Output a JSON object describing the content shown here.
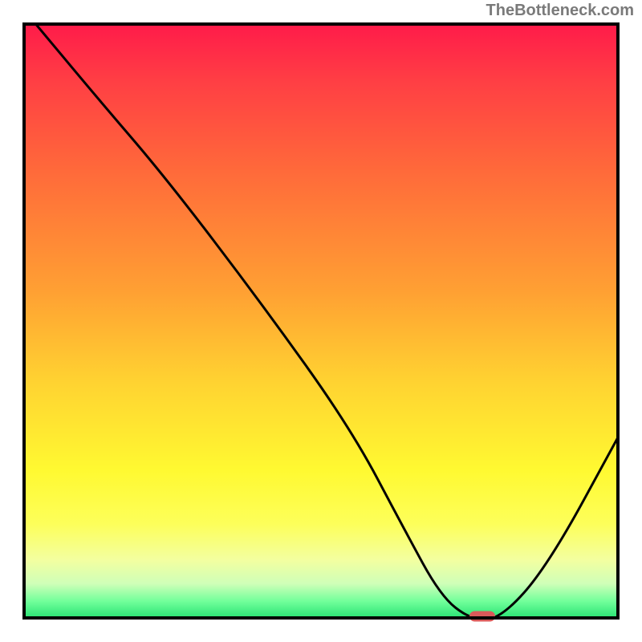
{
  "watermark": "TheBottleneck.com",
  "chart_data": {
    "type": "line",
    "title": "",
    "xlabel": "",
    "ylabel": "",
    "xlim": [
      0,
      100
    ],
    "ylim": [
      0,
      100
    ],
    "grid": false,
    "background_gradient": {
      "direction": "vertical",
      "stops": [
        {
          "pos": 0,
          "color": "#ff1a4a"
        },
        {
          "pos": 25,
          "color": "#ff6a3a"
        },
        {
          "pos": 60,
          "color": "#ffd231"
        },
        {
          "pos": 84,
          "color": "#fdff5a"
        },
        {
          "pos": 94,
          "color": "#cfffb8"
        },
        {
          "pos": 100,
          "color": "#22e070"
        }
      ]
    },
    "series": [
      {
        "name": "bottleneck-curve",
        "x": [
          2,
          12,
          24,
          40,
          55,
          64,
          70,
          75,
          80,
          88,
          100
        ],
        "y": [
          100,
          88,
          74,
          53,
          32,
          15,
          4,
          0,
          0,
          9,
          31
        ],
        "style": {
          "stroke": "#000000",
          "stroke_width": 3,
          "fill": "none"
        }
      }
    ],
    "marker": {
      "name": "optimal-point",
      "x": 77,
      "y": 0.5,
      "shape": "rounded-pill",
      "color": "#d95a5a"
    }
  }
}
